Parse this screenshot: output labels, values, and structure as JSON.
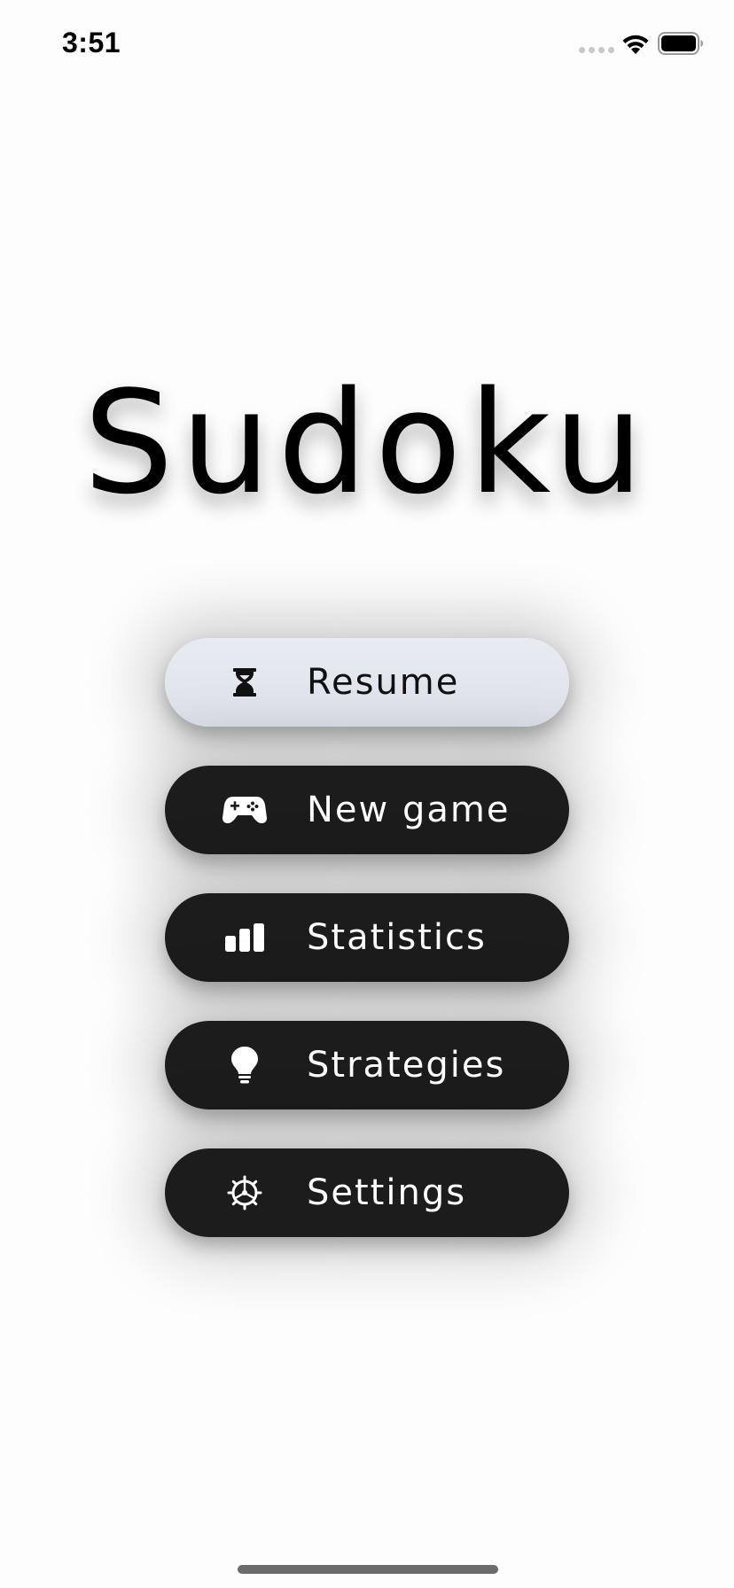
{
  "status_bar": {
    "time": "3:51"
  },
  "app": {
    "title": "Sudoku"
  },
  "menu": {
    "items": [
      {
        "id": "resume",
        "label": "Resume",
        "icon": "hourglass-icon"
      },
      {
        "id": "new-game",
        "label": "New game",
        "icon": "gamepad-icon"
      },
      {
        "id": "statistics",
        "label": "Statistics",
        "icon": "bar-chart-icon"
      },
      {
        "id": "strategies",
        "label": "Strategies",
        "icon": "lightbulb-icon"
      },
      {
        "id": "settings",
        "label": "Settings",
        "icon": "gear-icon"
      }
    ]
  },
  "colors": {
    "background": "#fdfdfd",
    "primary_button": "#e3e6ed",
    "dark_button": "#1c1c1c",
    "dark_button_text": "#ffffff",
    "title_text": "#000000"
  }
}
